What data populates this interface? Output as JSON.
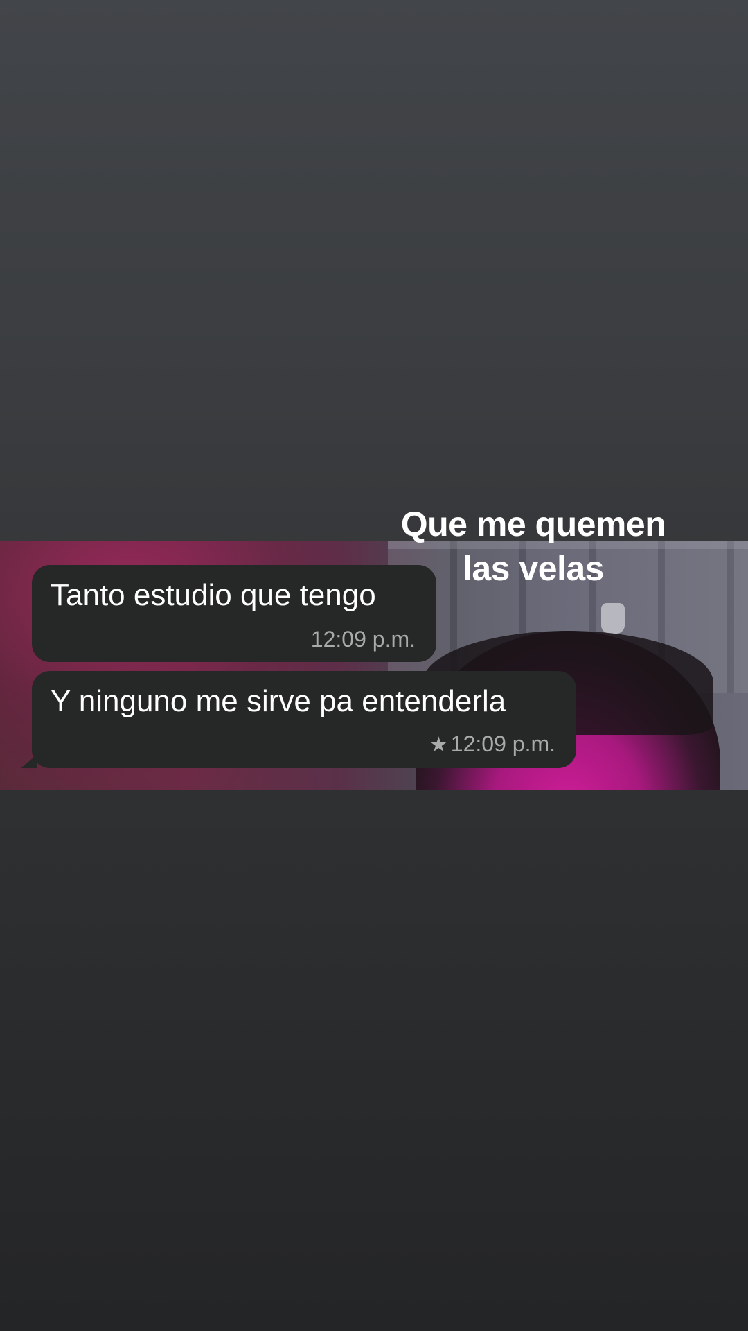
{
  "caption": {
    "line1": "Que me quemen",
    "line2": "las velas"
  },
  "messages": [
    {
      "text": "Tanto estudio que tengo",
      "time": "12:09 p.m.",
      "starred": false
    },
    {
      "text": "Y ninguno me sirve pa entenderla",
      "time": "12:09 p.m.",
      "starred": true
    }
  ],
  "icons": {
    "star": "star-icon"
  },
  "colors": {
    "bubble": "#262828",
    "timestamp": "#a9abab",
    "text": "#ffffff"
  }
}
